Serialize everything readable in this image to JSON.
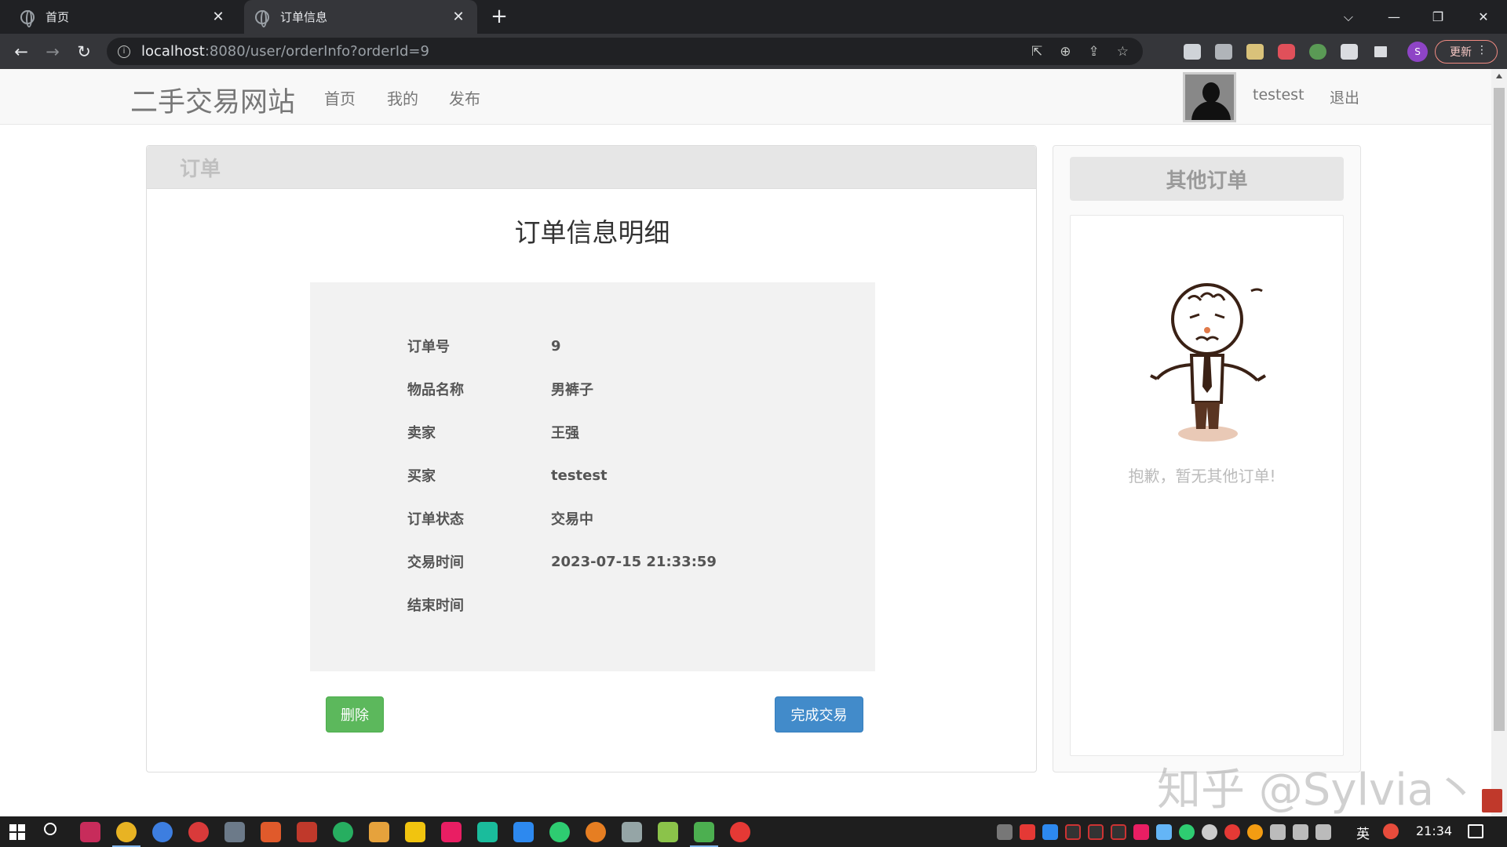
{
  "browser": {
    "tabs": [
      {
        "title": "首页",
        "active": false
      },
      {
        "title": "订单信息",
        "active": true
      }
    ],
    "new_tab": "+",
    "close_glyph": "✕",
    "url_host": "localhost",
    "url_path": ":8080/user/orderInfo?orderId=9",
    "update_label": "更新",
    "profile_initial": "S"
  },
  "site": {
    "brand": "二手交易网站",
    "nav": [
      "首页",
      "我的",
      "发布"
    ],
    "username": "testest",
    "logout": "退出"
  },
  "order_panel": {
    "header": "订单",
    "title": "订单信息明细",
    "fields": [
      {
        "label": "订单号",
        "value": "9"
      },
      {
        "label": "物品名称",
        "value": "男裤子"
      },
      {
        "label": "卖家",
        "value": "王强"
      },
      {
        "label": "买家",
        "value": "testest"
      },
      {
        "label": "订单状态",
        "value": "交易中"
      },
      {
        "label": "交易时间",
        "value": "2023-07-15 21:33:59"
      },
      {
        "label": "结束时间",
        "value": ""
      }
    ],
    "delete_button": "删除",
    "finish_button": "完成交易"
  },
  "side_panel": {
    "header": "其他订单",
    "empty_text": "抱歉，暂无其他订单!"
  },
  "watermark": "知乎 @Sylvia丶",
  "taskbar": {
    "language": "英",
    "clock": "21:34"
  },
  "colors": {
    "delete_green": "#5cb85c",
    "finish_blue": "#428bca",
    "panel_header_gray": "#e6e6e6",
    "chrome_dark": "#202124"
  }
}
